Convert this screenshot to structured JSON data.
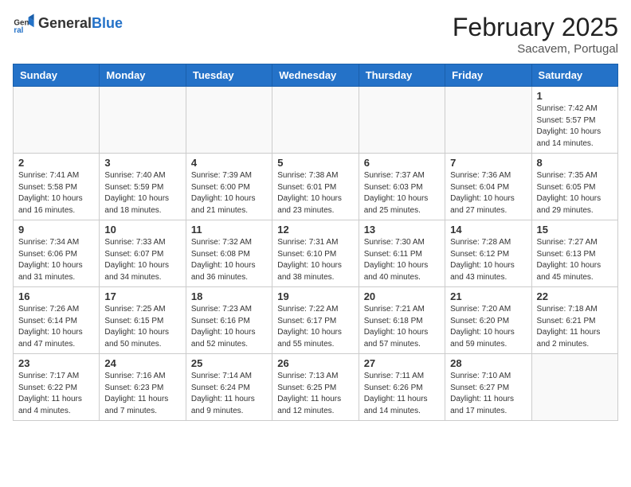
{
  "header": {
    "logo_general": "General",
    "logo_blue": "Blue",
    "month_year": "February 2025",
    "location": "Sacavem, Portugal"
  },
  "days_of_week": [
    "Sunday",
    "Monday",
    "Tuesday",
    "Wednesday",
    "Thursday",
    "Friday",
    "Saturday"
  ],
  "weeks": [
    [
      {
        "day": "",
        "info": ""
      },
      {
        "day": "",
        "info": ""
      },
      {
        "day": "",
        "info": ""
      },
      {
        "day": "",
        "info": ""
      },
      {
        "day": "",
        "info": ""
      },
      {
        "day": "",
        "info": ""
      },
      {
        "day": "1",
        "info": "Sunrise: 7:42 AM\nSunset: 5:57 PM\nDaylight: 10 hours and 14 minutes."
      }
    ],
    [
      {
        "day": "2",
        "info": "Sunrise: 7:41 AM\nSunset: 5:58 PM\nDaylight: 10 hours and 16 minutes."
      },
      {
        "day": "3",
        "info": "Sunrise: 7:40 AM\nSunset: 5:59 PM\nDaylight: 10 hours and 18 minutes."
      },
      {
        "day": "4",
        "info": "Sunrise: 7:39 AM\nSunset: 6:00 PM\nDaylight: 10 hours and 21 minutes."
      },
      {
        "day": "5",
        "info": "Sunrise: 7:38 AM\nSunset: 6:01 PM\nDaylight: 10 hours and 23 minutes."
      },
      {
        "day": "6",
        "info": "Sunrise: 7:37 AM\nSunset: 6:03 PM\nDaylight: 10 hours and 25 minutes."
      },
      {
        "day": "7",
        "info": "Sunrise: 7:36 AM\nSunset: 6:04 PM\nDaylight: 10 hours and 27 minutes."
      },
      {
        "day": "8",
        "info": "Sunrise: 7:35 AM\nSunset: 6:05 PM\nDaylight: 10 hours and 29 minutes."
      }
    ],
    [
      {
        "day": "9",
        "info": "Sunrise: 7:34 AM\nSunset: 6:06 PM\nDaylight: 10 hours and 31 minutes."
      },
      {
        "day": "10",
        "info": "Sunrise: 7:33 AM\nSunset: 6:07 PM\nDaylight: 10 hours and 34 minutes."
      },
      {
        "day": "11",
        "info": "Sunrise: 7:32 AM\nSunset: 6:08 PM\nDaylight: 10 hours and 36 minutes."
      },
      {
        "day": "12",
        "info": "Sunrise: 7:31 AM\nSunset: 6:10 PM\nDaylight: 10 hours and 38 minutes."
      },
      {
        "day": "13",
        "info": "Sunrise: 7:30 AM\nSunset: 6:11 PM\nDaylight: 10 hours and 40 minutes."
      },
      {
        "day": "14",
        "info": "Sunrise: 7:28 AM\nSunset: 6:12 PM\nDaylight: 10 hours and 43 minutes."
      },
      {
        "day": "15",
        "info": "Sunrise: 7:27 AM\nSunset: 6:13 PM\nDaylight: 10 hours and 45 minutes."
      }
    ],
    [
      {
        "day": "16",
        "info": "Sunrise: 7:26 AM\nSunset: 6:14 PM\nDaylight: 10 hours and 47 minutes."
      },
      {
        "day": "17",
        "info": "Sunrise: 7:25 AM\nSunset: 6:15 PM\nDaylight: 10 hours and 50 minutes."
      },
      {
        "day": "18",
        "info": "Sunrise: 7:23 AM\nSunset: 6:16 PM\nDaylight: 10 hours and 52 minutes."
      },
      {
        "day": "19",
        "info": "Sunrise: 7:22 AM\nSunset: 6:17 PM\nDaylight: 10 hours and 55 minutes."
      },
      {
        "day": "20",
        "info": "Sunrise: 7:21 AM\nSunset: 6:18 PM\nDaylight: 10 hours and 57 minutes."
      },
      {
        "day": "21",
        "info": "Sunrise: 7:20 AM\nSunset: 6:20 PM\nDaylight: 10 hours and 59 minutes."
      },
      {
        "day": "22",
        "info": "Sunrise: 7:18 AM\nSunset: 6:21 PM\nDaylight: 11 hours and 2 minutes."
      }
    ],
    [
      {
        "day": "23",
        "info": "Sunrise: 7:17 AM\nSunset: 6:22 PM\nDaylight: 11 hours and 4 minutes."
      },
      {
        "day": "24",
        "info": "Sunrise: 7:16 AM\nSunset: 6:23 PM\nDaylight: 11 hours and 7 minutes."
      },
      {
        "day": "25",
        "info": "Sunrise: 7:14 AM\nSunset: 6:24 PM\nDaylight: 11 hours and 9 minutes."
      },
      {
        "day": "26",
        "info": "Sunrise: 7:13 AM\nSunset: 6:25 PM\nDaylight: 11 hours and 12 minutes."
      },
      {
        "day": "27",
        "info": "Sunrise: 7:11 AM\nSunset: 6:26 PM\nDaylight: 11 hours and 14 minutes."
      },
      {
        "day": "28",
        "info": "Sunrise: 7:10 AM\nSunset: 6:27 PM\nDaylight: 11 hours and 17 minutes."
      },
      {
        "day": "",
        "info": ""
      }
    ]
  ]
}
